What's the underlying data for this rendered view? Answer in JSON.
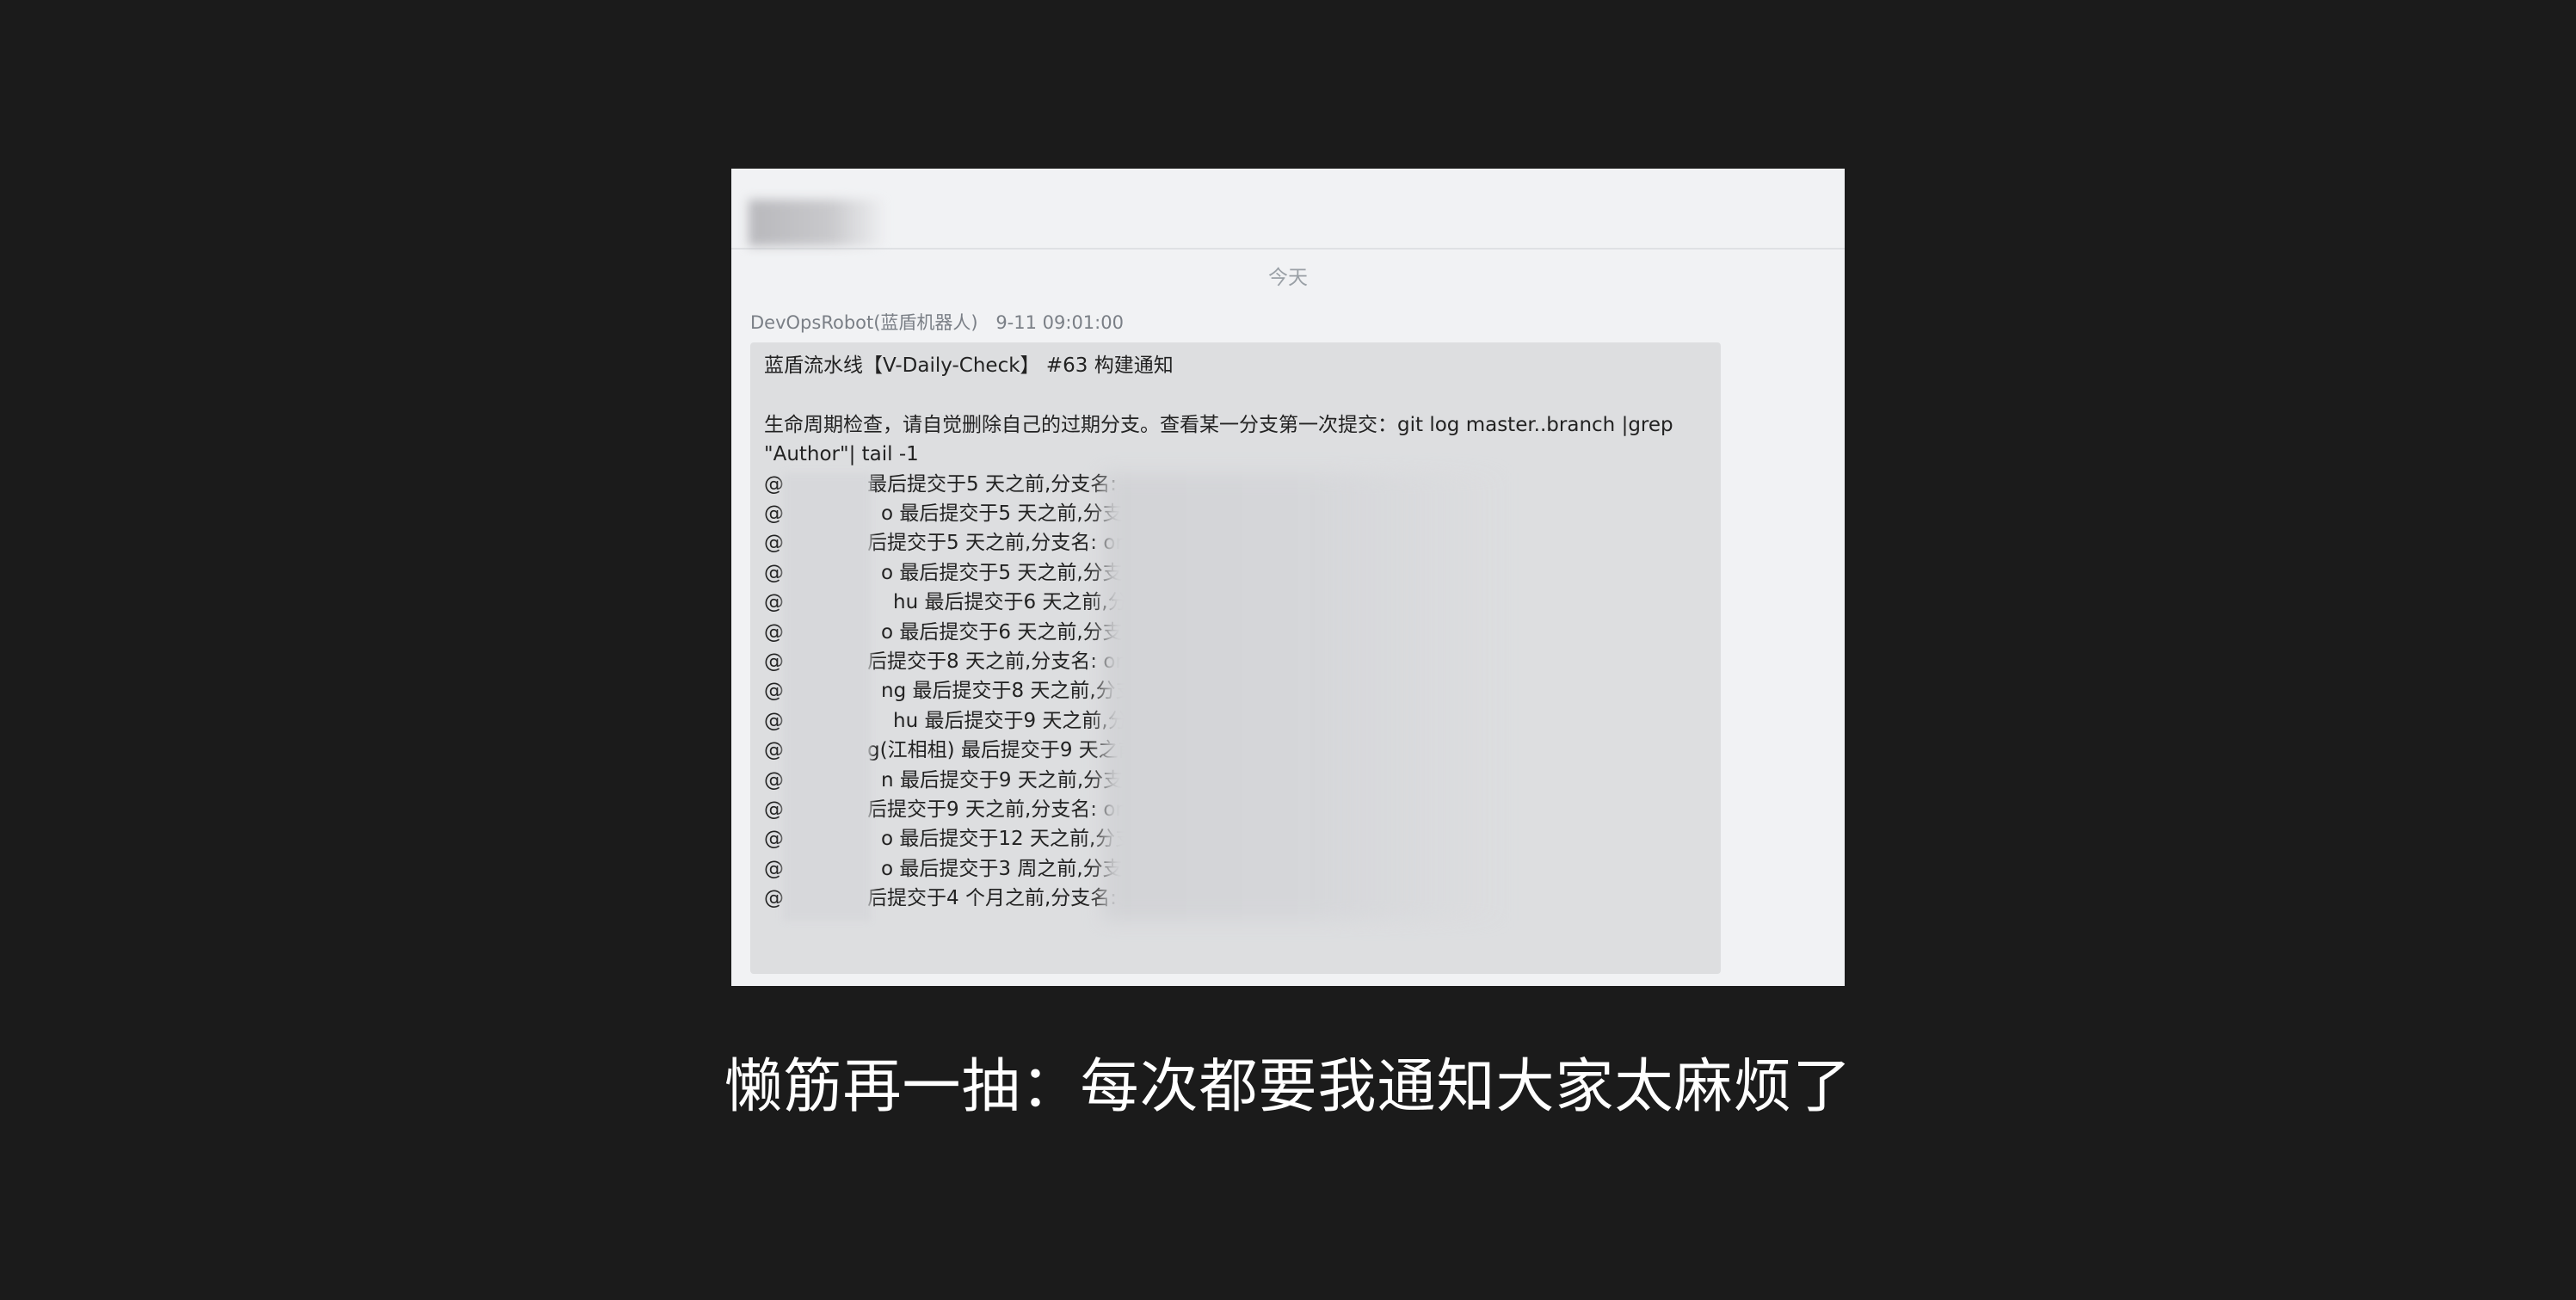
{
  "caption": "懒筋再一抽：每次都要我通知大家太麻烦了",
  "chat": {
    "title": "",
    "date_divider": "今天",
    "sender": "DevOpsRobot(蓝盾机器人)",
    "time": "9-11 09:01:00",
    "message": {
      "title": "蓝盾流水线【V-Daily-Check】 #63 构建通知",
      "body": "生命周期检查，请自觉删除自己的过期分支。查看某一分支第一次提交：git log master..branch |grep \"Author\"| tail -1",
      "mentions": [
        {
          "at": "@",
          "text": "最后提交于5 天之前,分支名:"
        },
        {
          "at": "@",
          "text": "o 最后提交于5 天之前,分支名"
        },
        {
          "at": "@",
          "text": "后提交于5 天之前,分支名: orig"
        },
        {
          "at": "@",
          "text": "o 最后提交于5 天之前,分支名"
        },
        {
          "at": "@",
          "text": "hu 最后提交于6 天之前,分支"
        },
        {
          "at": "@",
          "text": "o 最后提交于6 天之前,分支名"
        },
        {
          "at": "@",
          "text": "后提交于8 天之前,分支名: orig"
        },
        {
          "at": "@",
          "text": "ng 最后提交于8 天之前,分支名"
        },
        {
          "at": "@",
          "text": "hu 最后提交于9 天之前,分支"
        },
        {
          "at": "@",
          "text": "g(江相柤) 最后提交于9 天之前"
        },
        {
          "at": "@",
          "text": "n 最后提交于9 天之前,分支名"
        },
        {
          "at": "@",
          "text": "后提交于9 天之前,分支名: or"
        },
        {
          "at": "@",
          "text": "o 最后提交于12 天之前,分支"
        },
        {
          "at": "@",
          "text": "o 最后提交于3 周之前,分支名"
        },
        {
          "at": "@",
          "text": "后提交于4 个月之前,分支名:"
        }
      ]
    }
  },
  "colors": {
    "background": "#1b1b1b",
    "card": "#f1f2f4",
    "bubble": "#dddee0",
    "caption": "#ffffff"
  }
}
